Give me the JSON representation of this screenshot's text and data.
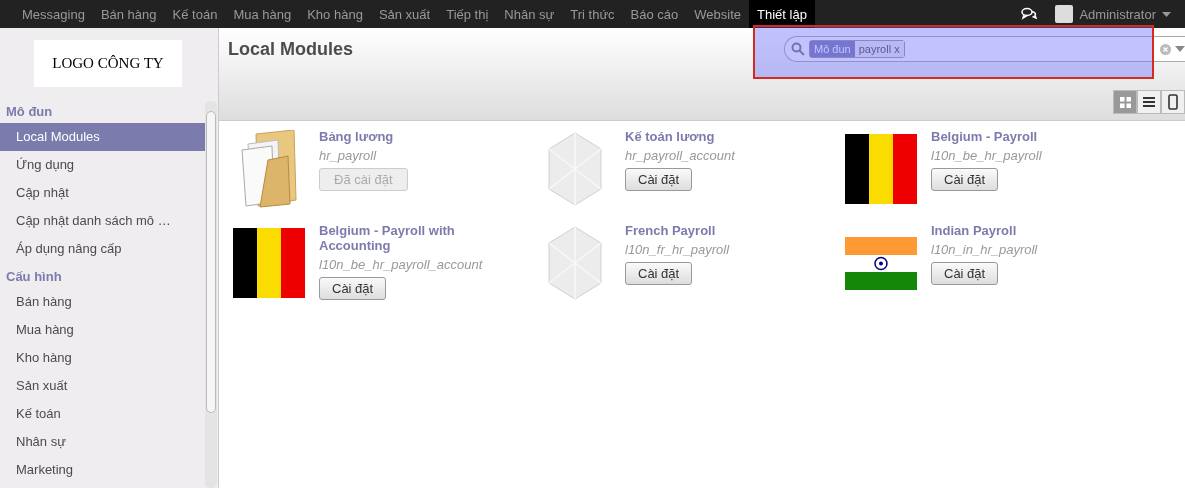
{
  "top_menu": [
    {
      "label": "Messaging",
      "selected": false
    },
    {
      "label": "Bán hàng",
      "selected": false
    },
    {
      "label": "Kế toán",
      "selected": false
    },
    {
      "label": "Mua hàng",
      "selected": false
    },
    {
      "label": "Kho hàng",
      "selected": false
    },
    {
      "label": "Sản xuất",
      "selected": false
    },
    {
      "label": "Tiếp thị",
      "selected": false
    },
    {
      "label": "Nhân sự",
      "selected": false
    },
    {
      "label": "Tri thức",
      "selected": false
    },
    {
      "label": "Báo cáo",
      "selected": false
    },
    {
      "label": "Website",
      "selected": false
    },
    {
      "label": "Thiết lập",
      "selected": true
    }
  ],
  "user": {
    "name": "Administrator"
  },
  "logo": {
    "text": "LOGO CÔNG TY"
  },
  "sidebar": {
    "sections": [
      {
        "title": "Mô đun",
        "items": [
          {
            "label": "Local Modules",
            "selected": true
          },
          {
            "label": "Ứng dụng",
            "selected": false
          },
          {
            "label": "Cập nhật",
            "selected": false
          },
          {
            "label": "Cập nhật danh sách mô …",
            "selected": false
          },
          {
            "label": "Áp dụng nâng cấp",
            "selected": false
          }
        ]
      },
      {
        "title": "Cấu hình",
        "items": [
          {
            "label": "Bán hàng",
            "selected": false
          },
          {
            "label": "Mua hàng",
            "selected": false
          },
          {
            "label": "Kho hàng",
            "selected": false
          },
          {
            "label": "Sản xuất",
            "selected": false
          },
          {
            "label": "Kế toán",
            "selected": false
          },
          {
            "label": "Nhân sự",
            "selected": false
          },
          {
            "label": "Marketing",
            "selected": false
          }
        ]
      }
    ]
  },
  "page": {
    "title": "Local Modules"
  },
  "search": {
    "facet_label": "Mô đun",
    "facet_value": "payroll",
    "facet_remove": "x"
  },
  "view_switcher": [
    {
      "kind": "kanban",
      "selected": true
    },
    {
      "kind": "list",
      "selected": false
    },
    {
      "kind": "form",
      "selected": false
    }
  ],
  "modules": [
    {
      "name": "Bảng lương",
      "technical_name": "hr_payroll",
      "kind": "folder",
      "button": "Đã cài đặt",
      "installed": true
    },
    {
      "name": "Kế toán lương",
      "technical_name": "hr_payroll_account",
      "kind": "cube",
      "button": "Cài đặt",
      "installed": false
    },
    {
      "name": "Belgium - Payroll",
      "technical_name": "l10n_be_hr_payroll",
      "kind": "flag-be",
      "button": "Cài đặt",
      "installed": false
    },
    {
      "name": "Belgium - Payroll with Accounting",
      "technical_name": "l10n_be_hr_payroll_account",
      "kind": "flag-be",
      "button": "Cài đặt",
      "installed": false
    },
    {
      "name": "French Payroll",
      "technical_name": "l10n_fr_hr_payroll",
      "kind": "cube",
      "button": "Cài đặt",
      "installed": false
    },
    {
      "name": "Indian Payroll",
      "technical_name": "l10n_in_hr_payroll",
      "kind": "flag-in",
      "button": "Cài đặt",
      "installed": false
    }
  ]
}
